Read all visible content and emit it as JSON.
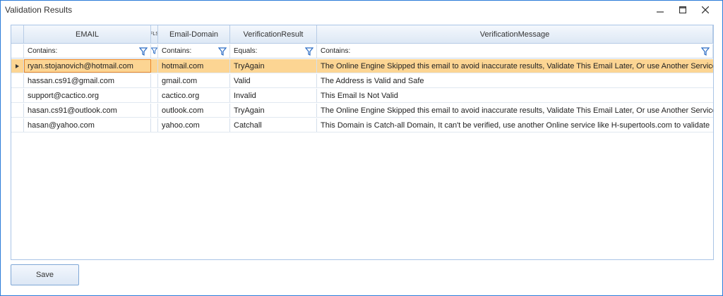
{
  "window": {
    "title": "Validation Results"
  },
  "grid": {
    "columns": [
      {
        "key": "email",
        "label": "EMAIL"
      },
      {
        "key": "gap",
        "label": "FLS"
      },
      {
        "key": "domain",
        "label": "Email-Domain"
      },
      {
        "key": "result",
        "label": "VerificationResult"
      },
      {
        "key": "message",
        "label": "VerificationMessage"
      }
    ],
    "filters": {
      "email": "Contains:",
      "domain": "Contains:",
      "result": "Equals:",
      "message": "Contains:"
    },
    "rows": [
      {
        "email": "ryan.stojanovich@hotmail.com",
        "domain": "hotmail.com",
        "result": "TryAgain",
        "message": "The Online Engine Skipped this email to avoid inaccurate results, Validate This Email Later, Or use Another Service Like H-su..."
      },
      {
        "email": "hassan.cs91@gmail.com",
        "domain": "gmail.com",
        "result": "Valid",
        "message": "The Address is Valid and Safe"
      },
      {
        "email": "support@cactico.org",
        "domain": "cactico.org",
        "result": "Invalid",
        "message": "This Email Is Not Valid"
      },
      {
        "email": "hasan.cs91@outlook.com",
        "domain": "outlook.com",
        "result": "TryAgain",
        "message": "The Online Engine Skipped this email to avoid inaccurate results, Validate This Email Later, Or use Another Service Like H-su..."
      },
      {
        "email": "hasan@yahoo.com",
        "domain": "yahoo.com",
        "result": "Catchall",
        "message": "This Domain is Catch-all Domain, It can't be verified, use another Online service like H-supertools.com to validate"
      }
    ],
    "selected_row": 0
  },
  "actions": {
    "save_label": "Save"
  },
  "colors": {
    "selected_row": "#fcd593",
    "accent": "#2b7bd8",
    "focus_border": "#e8862a"
  }
}
